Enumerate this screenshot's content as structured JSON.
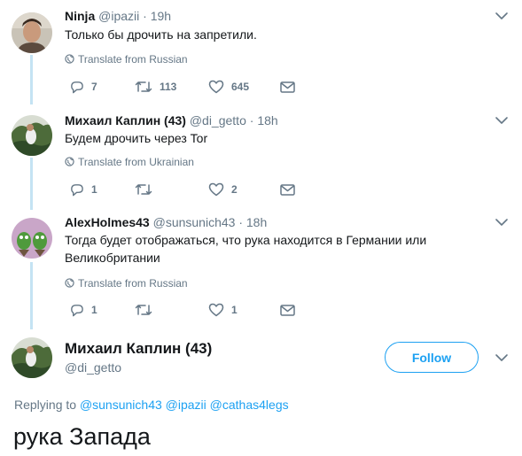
{
  "tweets": [
    {
      "name": "Ninja",
      "handle": "@ipazii",
      "time": "· 19h",
      "text": "Только бы дрочить на запретили.",
      "translate": "Translate from Russian",
      "replies": "7",
      "retweets": "113",
      "likes": "645"
    },
    {
      "name": "Михаил Каплин (43)",
      "handle": "@di_getto",
      "time": "· 18h",
      "text": "Будем дрочить через Tor",
      "translate": "Translate from Ukrainian",
      "replies": "1",
      "retweets": "",
      "likes": "2"
    },
    {
      "name": "AlexHolmes43",
      "handle": "@sunsunich43",
      "time": "· 18h",
      "text": "Тогда будет отображаться, что рука находится в Германии или Великобритании",
      "translate": "Translate from Russian",
      "replies": "1",
      "retweets": "",
      "likes": "1"
    }
  ],
  "main_tweet": {
    "name": "Михаил Каплин (43)",
    "handle": "@di_getto",
    "follow_label": "Follow",
    "replying_prefix": "Replying to",
    "mentions": [
      "@sunsunich43",
      "@ipazii",
      "@cathas4legs"
    ],
    "text": "рука Запада"
  },
  "colors": {
    "accent": "#1da1f2",
    "muted": "#657786",
    "thread_line": "#c4e3f3"
  }
}
